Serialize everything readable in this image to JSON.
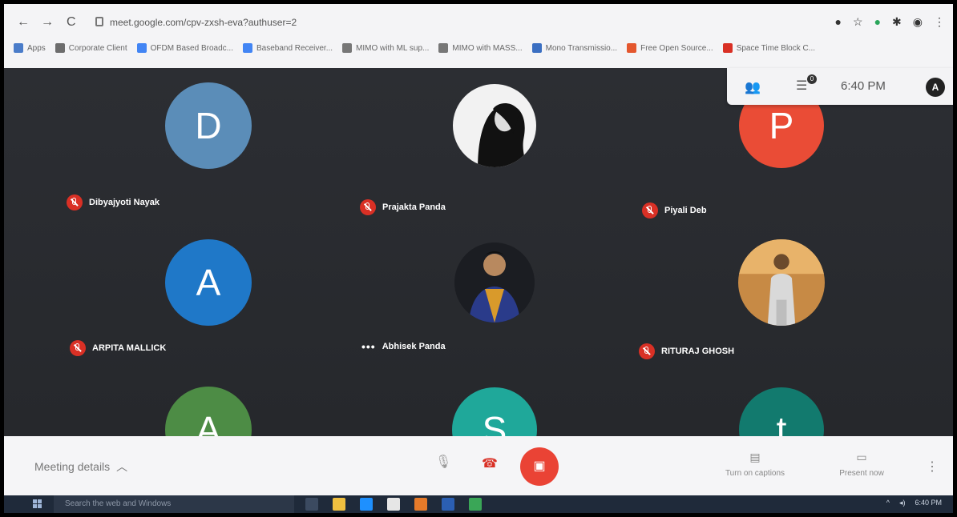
{
  "browser": {
    "url": "meet.google.com/cpv-zxsh-eva?authuser=2",
    "bookmarks": [
      {
        "label": "Apps",
        "color": "#4a7cc9"
      },
      {
        "label": "Corporate Client",
        "color": "#6d6d6d"
      },
      {
        "label": "OFDM Based Broadc...",
        "color": "#4285f4"
      },
      {
        "label": "Baseband Receiver...",
        "color": "#4285f4"
      },
      {
        "label": "MIMO with ML sup...",
        "color": "#777777"
      },
      {
        "label": "MIMO with MASS...",
        "color": "#777777"
      },
      {
        "label": "Mono Transmissio...",
        "color": "#3b6fc2"
      },
      {
        "label": "Free Open Source...",
        "color": "#e4572e"
      },
      {
        "label": "Space Time Block C...",
        "color": "#d93025"
      }
    ]
  },
  "meet": {
    "chat_count": "0",
    "time": "6:40 PM",
    "me_initial": "A"
  },
  "participants": [
    {
      "initial": "D",
      "name": "Dibyajyoti Nayak",
      "color": "#5b8db8",
      "muted": true,
      "kind": "letter"
    },
    {
      "initial": "",
      "name": "Prajakta Panda",
      "color": "#111111",
      "muted": true,
      "kind": "photo-bw"
    },
    {
      "initial": "P",
      "name": "Piyali Deb",
      "color": "#ea4c36",
      "muted": true,
      "kind": "letter"
    },
    {
      "initial": "A",
      "name": "ARPITA MALLICK",
      "color": "#1f78c8",
      "muted": true,
      "kind": "letter"
    },
    {
      "initial": "",
      "name": "Abhisek Panda",
      "color": "#2a3b6a",
      "muted": false,
      "kind": "photo-man"
    },
    {
      "initial": "",
      "name": "RITURAJ GHOSH",
      "color": "#c8894a",
      "muted": true,
      "kind": "photo-stage"
    },
    {
      "initial": "A",
      "name": "",
      "color": "#4d8c45",
      "muted": false,
      "kind": "letter"
    },
    {
      "initial": "S",
      "name": "",
      "color": "#1fa89a",
      "muted": false,
      "kind": "letter"
    },
    {
      "initial": "t",
      "name": "",
      "color": "#127a6e",
      "muted": false,
      "kind": "letter"
    }
  ],
  "controls": {
    "meeting_details": "Meeting details",
    "captions": "Turn on captions",
    "present": "Present now"
  },
  "taskbar": {
    "search_placeholder": "Search the web and Windows",
    "clock": "6:40 PM",
    "apps": [
      "#3b4a60",
      "#f0c040",
      "#1e90ff",
      "#e6e6e6",
      "#e57a2a",
      "#2b5fb3",
      "#3aa657"
    ]
  }
}
